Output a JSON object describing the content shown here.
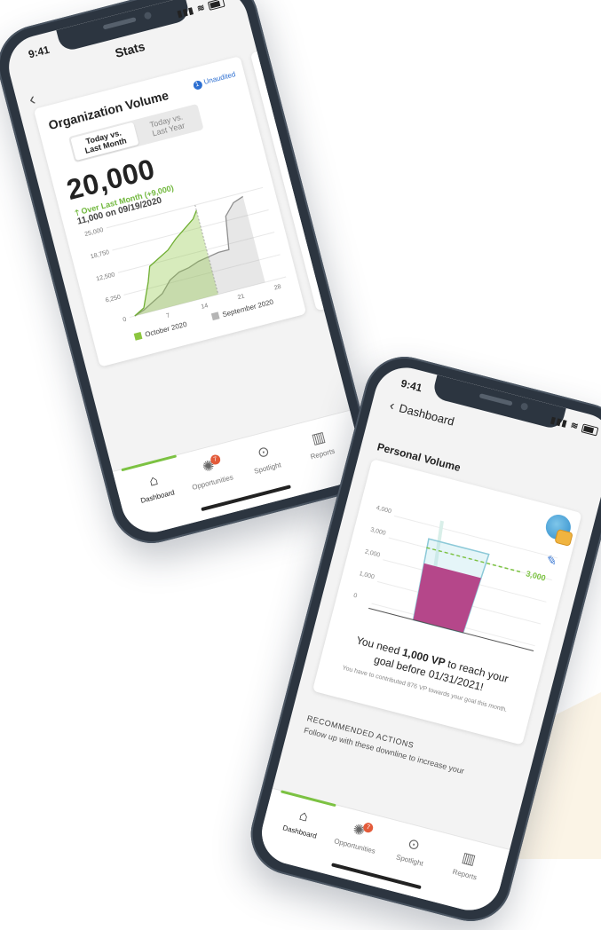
{
  "phone1": {
    "status_time": "9:41",
    "header_title": "Stats",
    "card": {
      "title": "Organization Volume",
      "audit_count": "1",
      "audit_label": "Unaudited",
      "segments": [
        "Today vs. Last Month",
        "Today vs. Last Year"
      ],
      "segment_lines": [
        [
          "Today vs.",
          "Last Month"
        ],
        [
          "Today vs.",
          "Last Year"
        ]
      ],
      "big_value": "20,000",
      "delta_text": "Over Last Month (+9,000)",
      "sub_text": "11,000 on 09/19/2020"
    },
    "chart_data": {
      "type": "area",
      "y_ticks": [
        "25,000",
        "18,750",
        "12,500",
        "6,250",
        "0"
      ],
      "x_ticks": [
        "7",
        "14",
        "21",
        "28"
      ],
      "ylim": [
        0,
        25000
      ],
      "series": [
        {
          "name": "October 2020",
          "color": "#8cc63f",
          "x": [
            1,
            3,
            5,
            6,
            8,
            10,
            12,
            14,
            16,
            17
          ],
          "values": [
            0,
            1500,
            8000,
            12000,
            13500,
            15000,
            17500,
            19500,
            21500,
            23500
          ]
        },
        {
          "name": "September 2020",
          "color": "#b5b5b5",
          "x": [
            1,
            3,
            5,
            7,
            9,
            11,
            13,
            15,
            17,
            19,
            21,
            22,
            24,
            26
          ],
          "values": [
            0,
            1000,
            2500,
            4000,
            7000,
            8500,
            9000,
            10000,
            10500,
            11000,
            11000,
            20000,
            23000,
            24000
          ]
        }
      ],
      "legend": [
        "October 2020",
        "September 2020"
      ]
    },
    "tabs": [
      {
        "label": "Dashboard",
        "icon": "home-icon"
      },
      {
        "label": "Opportunities",
        "icon": "lightbulb-icon",
        "badge": "7"
      },
      {
        "label": "Spotlight",
        "icon": "spotlight-icon"
      },
      {
        "label": "Reports",
        "icon": "bar-chart-icon"
      }
    ]
  },
  "phone2": {
    "status_time": "9:41",
    "back_label": "Dashboard",
    "section_title": "Personal Volume",
    "chart_data": {
      "type": "bar",
      "y_ticks": [
        "4,000",
        "3,000",
        "2,000",
        "1,000",
        "0"
      ],
      "ylim": [
        0,
        4000
      ],
      "goal_value": 3000,
      "goal_label": "3,000",
      "current_value": 2300,
      "fill_color": "#b5478a",
      "goal_color": "#7cc242"
    },
    "need_prefix": "You need ",
    "need_bold": "1,000 VP",
    "need_suffix": " to reach your",
    "need_line2": "goal before 01/31/2021!",
    "small_note": "You have to contributed 876 VP towards your goal this month.",
    "recommended_title": "RECOMMENDED ACTIONS",
    "recommended_sub": "Follow up with these downline to increase your",
    "tabs": [
      {
        "label": "Dashboard",
        "icon": "home-icon"
      },
      {
        "label": "Opportunities",
        "icon": "lightbulb-icon",
        "badge": "7"
      },
      {
        "label": "Spotlight",
        "icon": "spotlight-icon"
      },
      {
        "label": "Reports",
        "icon": "bar-chart-icon"
      }
    ]
  }
}
